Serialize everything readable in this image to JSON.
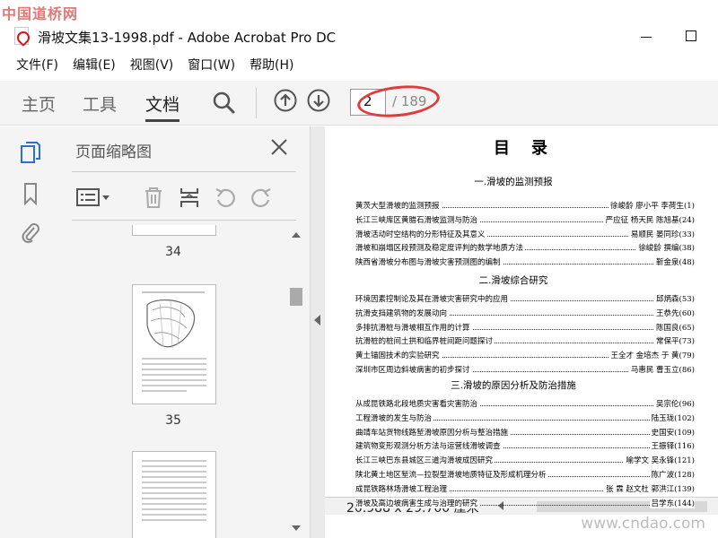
{
  "watermark": {
    "top": "中国道桥网",
    "bottom": "www.cndao.com"
  },
  "window": {
    "title": "滑坡文集13-1998.pdf - Adobe Acrobat Pro DC"
  },
  "menu": [
    "文件(F)",
    "编辑(E)",
    "视图(V)",
    "窗口(W)",
    "帮助(H)"
  ],
  "toolbar": {
    "tabs": [
      "主页",
      "工具",
      "文档"
    ],
    "active_tab": "文档",
    "page_current": "2",
    "page_total": "/ 189"
  },
  "icons": {
    "search": "search-icon",
    "up": "previous-page-icon",
    "down": "next-page-icon",
    "thumbs": "page-thumbnails-icon",
    "bookmark": "bookmark-icon",
    "attach": "attachment-icon",
    "close": "close-icon",
    "options": "thumbnail-options-icon",
    "delete": "trash-icon",
    "extract": "insert-pages-icon",
    "rotate_left": "rotate-ccw-icon",
    "rotate_right": "rotate-cw-icon"
  },
  "panel": {
    "title": "页面缩略图",
    "thumb_labels": [
      "34",
      "35"
    ]
  },
  "doc": {
    "title": "目录",
    "sections": [
      {
        "heading": "一.滑坡的监测预报",
        "items": [
          {
            "t": "黄茨大型滑坡的监测预报",
            "a": "徐峻龄 廖小平 李荷生(1)"
          },
          {
            "t": "长江三峡库区黄腊石滑坡监测与防治",
            "a": "严应征 杨天民 陈旭基(24)"
          },
          {
            "t": "滑坡活动时空结构的分形特征及其意义",
            "a": "易顺民 晏同珍(33)"
          },
          {
            "t": "滑坡和崩塌区段预测及稳定度评判的数学地质方法",
            "a": "徐峻龄 撰编(38)"
          },
          {
            "t": "陕西省滑坡分布图与滑坡灾害预测图的编制",
            "a": "靳金泉(48)"
          }
        ]
      },
      {
        "heading": "二.滑坡综合研究",
        "items": [
          {
            "t": "环境因素控制论及其在滑坡灾害研究中的应用",
            "a": "邱炳森(53)"
          },
          {
            "t": "抗滑支挡建筑物的发展动向",
            "a": "王恭先(60)"
          },
          {
            "t": "多排抗滑桩与滑坡相互作用的计算",
            "a": "陈国良(65)"
          },
          {
            "t": "抗滑桩的桩间土拱和临界桩间距问题探讨",
            "a": "常保平(73)"
          },
          {
            "t": "黄土锚固技术的实验研究",
            "a": "王全才 金培杰 于 黄(79)"
          },
          {
            "t": "深圳市区周边斜坡病害的初步探讨",
            "a": "马惠民 曹玉立(86)"
          }
        ]
      },
      {
        "heading": "三.滑坡的原因分析及防治措施",
        "items": [
          {
            "t": "从成昆铁路北段地质灾害看灾害防治",
            "a": "吴宗伦(96)"
          },
          {
            "t": "工程滑坡的发生与防治",
            "a": "陆玉珑(102)"
          },
          {
            "t": "曲靖车站货物线路堑滑坡原因分析与整治措施",
            "a": "史国安(109)"
          },
          {
            "t": "建筑物变形观测分析方法与运营线滑坡调查",
            "a": "王振铎(116)"
          },
          {
            "t": "长江三峡巴东县城区三道沟滑坡成因研究",
            "a": "喻学文 吴永锋(121)"
          },
          {
            "t": "陕北黄土地区堑流—拉裂型滑坡地质特征及形成机理分析",
            "a": "陈广波(128)"
          },
          {
            "t": "成昆铁路林场滑坡工程治理",
            "a": "张 霖 赵文杜 郭洪江(139)"
          },
          {
            "t": "滑坡及高边坡病害生成与治理的研究",
            "a": "吕学东(144)"
          }
        ]
      }
    ]
  },
  "statusbar": {
    "dimensions": "20.988 x 29.700 厘米"
  },
  "colors": {
    "annotation_red": "#e23b3b",
    "pdf_red": "#d4141a",
    "toolbar_bg": "#f4f4f4"
  }
}
